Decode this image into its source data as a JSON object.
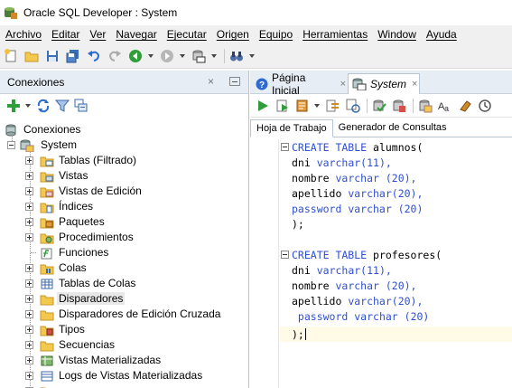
{
  "window": {
    "title": "Oracle SQL Developer : System"
  },
  "menu": [
    "Archivo",
    "Editar",
    "Ver",
    "Navegar",
    "Ejecutar",
    "Origen",
    "Equipo",
    "Herramientas",
    "Window",
    "Ayuda"
  ],
  "left_panel": {
    "title": "Conexiones",
    "close_glyph": "×",
    "root": "Conexiones",
    "connection": "System",
    "nodes": [
      "Tablas (Filtrado)",
      "Vistas",
      "Vistas de Edición",
      "Índices",
      "Paquetes",
      "Procedimientos",
      "Funciones",
      "Colas",
      "Tablas de Colas",
      "Disparadores",
      "Disparadores de Edición Cruzada",
      "Tipos",
      "Secuencias",
      "Vistas Materializadas",
      "Logs de Vistas Materializadas"
    ]
  },
  "doc_tabs": [
    {
      "label": "Página Inicial",
      "close": "×"
    },
    {
      "label": "System",
      "close": "×"
    }
  ],
  "sub_tabs": [
    "Hoja de Trabajo",
    "Generador de Consultas"
  ],
  "code": {
    "lines": [
      {
        "kw": "CREATE TABLE",
        "rest": " alumnos("
      },
      {
        "ident": "dni ",
        "type": "varchar",
        "rest": "(11),"
      },
      {
        "ident": "nombre ",
        "type": "varchar",
        "rest": " (20),"
      },
      {
        "ident": "apellido ",
        "type": "varchar",
        "rest": "(20),"
      },
      {
        "ident": "password ",
        "type": "varchar",
        "rest": " (20)"
      },
      {
        "ident": ");",
        "type": "",
        "rest": ""
      },
      {
        "ident": "",
        "type": "",
        "rest": ""
      },
      {
        "kw": "CREATE TABLE",
        "rest": " profesores("
      },
      {
        "ident": "dni ",
        "type": "varchar",
        "rest": "(11),"
      },
      {
        "ident": "nombre ",
        "type": "varchar",
        "rest": " (20),"
      },
      {
        "ident": "apellido ",
        "type": "varchar",
        "rest": "(20),"
      },
      {
        "ident": " password ",
        "type": "varchar",
        "rest": " (20)"
      },
      {
        "ident": ");",
        "type": "",
        "rest": ""
      }
    ]
  },
  "colors": {
    "keyword": "#2f4fd1",
    "panel_header": "#e7edf4",
    "current_line": "#fffbe6"
  }
}
